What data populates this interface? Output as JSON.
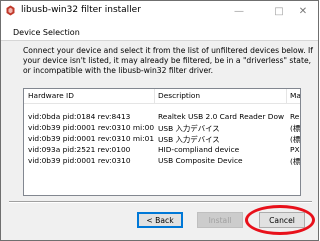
{
  "window": {
    "title": "libusb-win32 filter installer",
    "icon": "libusb-app-icon",
    "minimize": "—",
    "maximize": "□",
    "close": "✕"
  },
  "section": {
    "title": "Device Selection",
    "description": "Connect your device and select it from the list of unfiltered devices below. If your device isn't listed, it may already be filtered, be in a \"driverless\" state, or incompatible with the libusb-win32 filter driver."
  },
  "table": {
    "columns": [
      "Hardware ID",
      "Description",
      "Ma"
    ],
    "rows": [
      [
        "vid:0bda pid:0184 rev:8413",
        "Realtek USB 2.0 Card Reader Dow...",
        "Re"
      ],
      [
        "vid:0b39 pid:0001 rev:0310 mi:00",
        "USB 入力デバイス",
        "(標"
      ],
      [
        "vid:0b39 pid:0001 rev:0310 mi:01",
        "USB 入力デバイス",
        "(標"
      ],
      [
        "vid:093a pid:2521 rev:0100",
        "HID-compliand device",
        "PX"
      ],
      [
        "vid:0b39 pid:0001 rev:0310",
        "USB Composite Device",
        "(標"
      ]
    ]
  },
  "buttons": {
    "back": "< Back",
    "install": "Install",
    "cancel": "Cancel"
  },
  "colors": {
    "highlight": "#e8101a",
    "focus_border": "#0078d7"
  }
}
